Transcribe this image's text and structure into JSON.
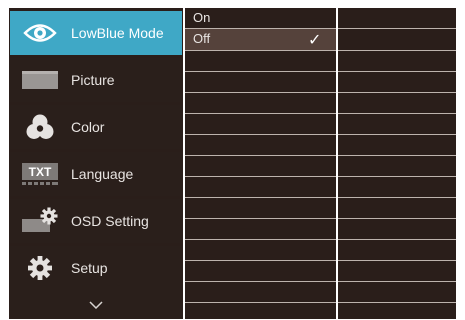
{
  "menu": {
    "items": [
      {
        "label": "LowBlue Mode",
        "icon": "eye-icon",
        "active": true
      },
      {
        "label": "Picture",
        "icon": "picture-icon",
        "active": false
      },
      {
        "label": "Color",
        "icon": "color-icon",
        "active": false
      },
      {
        "label": "Language",
        "icon": "language-icon",
        "active": false
      },
      {
        "label": "OSD Setting",
        "icon": "osd-setting-icon",
        "active": false
      },
      {
        "label": "Setup",
        "icon": "gear-icon",
        "active": false
      }
    ],
    "language_icon_text": "TXT",
    "more_icon": "chevron-down-icon"
  },
  "options": {
    "items": [
      {
        "label": "On",
        "selected": false
      },
      {
        "label": "Off",
        "selected": true,
        "checked": true
      }
    ],
    "check_glyph": "✓"
  },
  "colors": {
    "accent": "#3fa8c6",
    "background": "#2a1e1a",
    "selected_row": "#55423b",
    "text": "#e8e4e2"
  }
}
